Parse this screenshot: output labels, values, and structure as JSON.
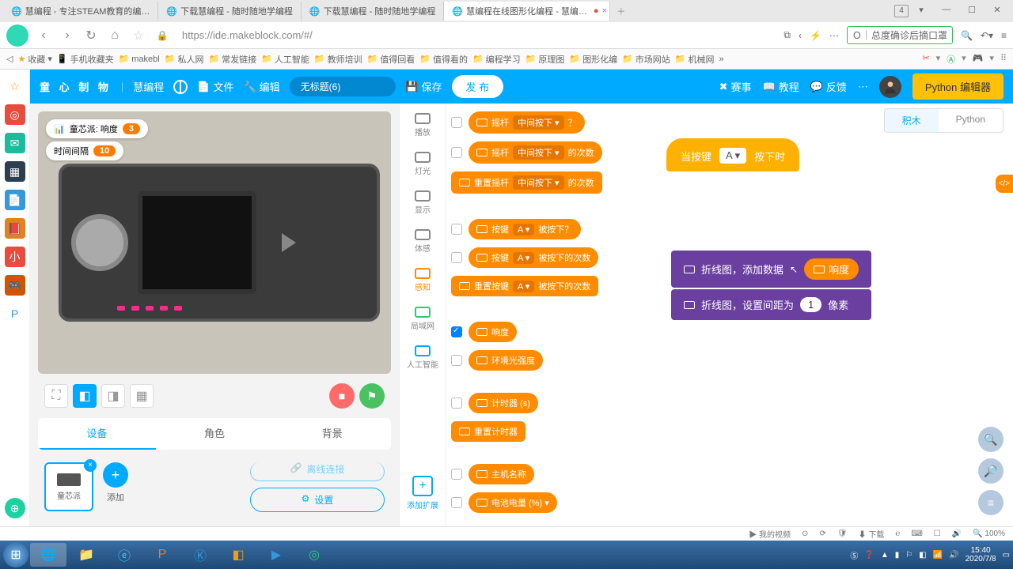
{
  "browser": {
    "tabs": [
      {
        "icon": "🌐",
        "label": "慧编程 - 专注STEAM教育的编…"
      },
      {
        "icon": "🌐",
        "label": "下载慧编程 - 随时随地学编程"
      },
      {
        "icon": "🌐",
        "label": "下载慧编程 - 随时随地学编程"
      },
      {
        "icon": "🌐",
        "label": "慧编程在线图形化编程 - 慧编…",
        "active": true
      }
    ],
    "tab_counter": "4",
    "url": "https://ide.makeblock.com/#/",
    "search_placeholder": "总度确诊后摘口罩",
    "bookmarks_label": "收藏",
    "bookmarks": [
      "手机收藏夹",
      "makebl",
      "私人网",
      "常发链接",
      "人工智能",
      "教师培训",
      "值得回看",
      "值得看的",
      "编程学习",
      "原理图",
      "图形化编",
      "市场网站",
      "机械网"
    ]
  },
  "app": {
    "brand": "童 心 制 物",
    "brand2": "慧编程",
    "menu": {
      "lang": "🌐",
      "file": "文件",
      "edit": "编辑"
    },
    "project_title": "无标题(6)",
    "save": "保存",
    "publish": "发 布",
    "right": {
      "match": "赛事",
      "tutorial": "教程",
      "feedback": "反馈",
      "more": "⋯",
      "python_btn": "Python 编辑器"
    }
  },
  "stage": {
    "monitor1": {
      "label": "童芯派: 响度",
      "value": "3"
    },
    "monitor2": {
      "label": "时间间隔",
      "value": "10"
    },
    "asset_tabs": {
      "device": "设备",
      "sprite": "角色",
      "bg": "背景"
    },
    "device_name": "童芯派",
    "add_label": "添加",
    "link_btn": "离线连接",
    "settings_btn": "设置"
  },
  "categories": {
    "c1": "播放",
    "c2": "灯光",
    "c3": "显示",
    "c4": "体感",
    "c5": "感知",
    "c6": "局域网",
    "c7": "人工智能",
    "add": "添加扩展"
  },
  "palette": {
    "b1": {
      "t1": "摇杆",
      "dd": "中间按下 ▾",
      "t2": "？"
    },
    "b2": {
      "t1": "摇杆",
      "dd": "中间按下 ▾",
      "t2": "的次数"
    },
    "b3": {
      "t1": "重置摇杆",
      "dd": "中间按下 ▾",
      "t2": "的次数"
    },
    "b4": {
      "t1": "按键",
      "dd": "A ▾",
      "t2": "被按下？"
    },
    "b5": {
      "t1": "按键",
      "dd": "A ▾",
      "t2": "被按下的次数"
    },
    "b6": {
      "t1": "重置按键",
      "dd": "A ▾",
      "t2": "被按下的次数"
    },
    "b7": {
      "t": "响度"
    },
    "b8": {
      "t": "环境光强度"
    },
    "b9": {
      "t": "计时器 (s)"
    },
    "b10": {
      "t": "重置计时器"
    },
    "b11": {
      "t": "主机名称"
    },
    "b12": {
      "t": "电池电量 (%) ▾"
    }
  },
  "canvas": {
    "tabs": {
      "blocks": "积木",
      "python": "Python"
    },
    "side_handle": "</>",
    "hat": {
      "t1": "当按键",
      "key": "A ▾",
      "t2": "按下时"
    },
    "s1": {
      "t1": "折线图，添加数据",
      "pill": "响度"
    },
    "s2": {
      "t1": "折线图，设置间距为",
      "num": "1",
      "t2": "像素"
    }
  },
  "statusbar": {
    "video": "我的视频",
    "dl": "下载",
    "zoom": "100%"
  },
  "taskbar": {
    "time": "15:40",
    "date": "2020/7/8"
  }
}
